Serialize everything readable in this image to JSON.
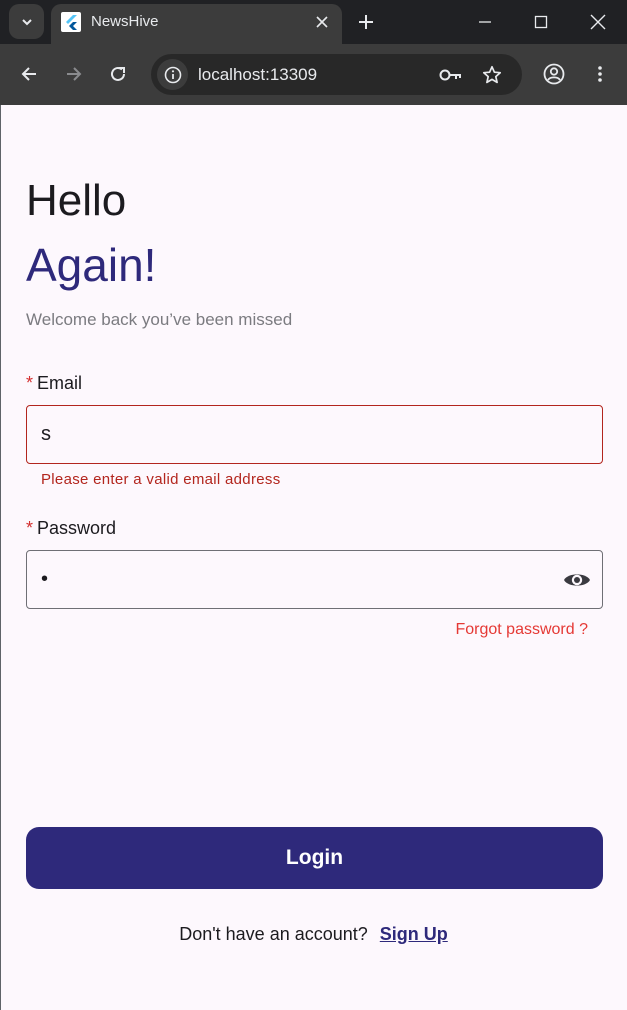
{
  "browser": {
    "tab_title": "NewsHive",
    "url": "localhost:13309",
    "icons": [
      "tab-search-icon",
      "flutter-favicon-icon",
      "close-icon",
      "plus-icon",
      "minimize-icon",
      "maximize-icon",
      "window-close-icon",
      "back-icon",
      "forward-icon",
      "reload-icon",
      "info-icon",
      "key-icon",
      "star-icon",
      "profile-icon",
      "more-vert-icon"
    ]
  },
  "login": {
    "heading_line1": "Hello",
    "heading_line2": "Again!",
    "subtitle": "Welcome back you’ve been missed",
    "email": {
      "required_mark": "*",
      "label": "Email",
      "value": "s",
      "error": "Please enter a valid email address"
    },
    "password": {
      "required_mark": "*",
      "label": "Password",
      "value": "•",
      "toggle_icon": "eye-icon"
    },
    "forgot_password": "Forgot password ?",
    "login_button": "Login",
    "signup_prompt": "Don't have an account?",
    "signup_link": "Sign Up"
  },
  "colors": {
    "primary": "#2e297b",
    "error": "#b3261e",
    "link_red": "#e53935",
    "background": "#fdf8fd"
  }
}
